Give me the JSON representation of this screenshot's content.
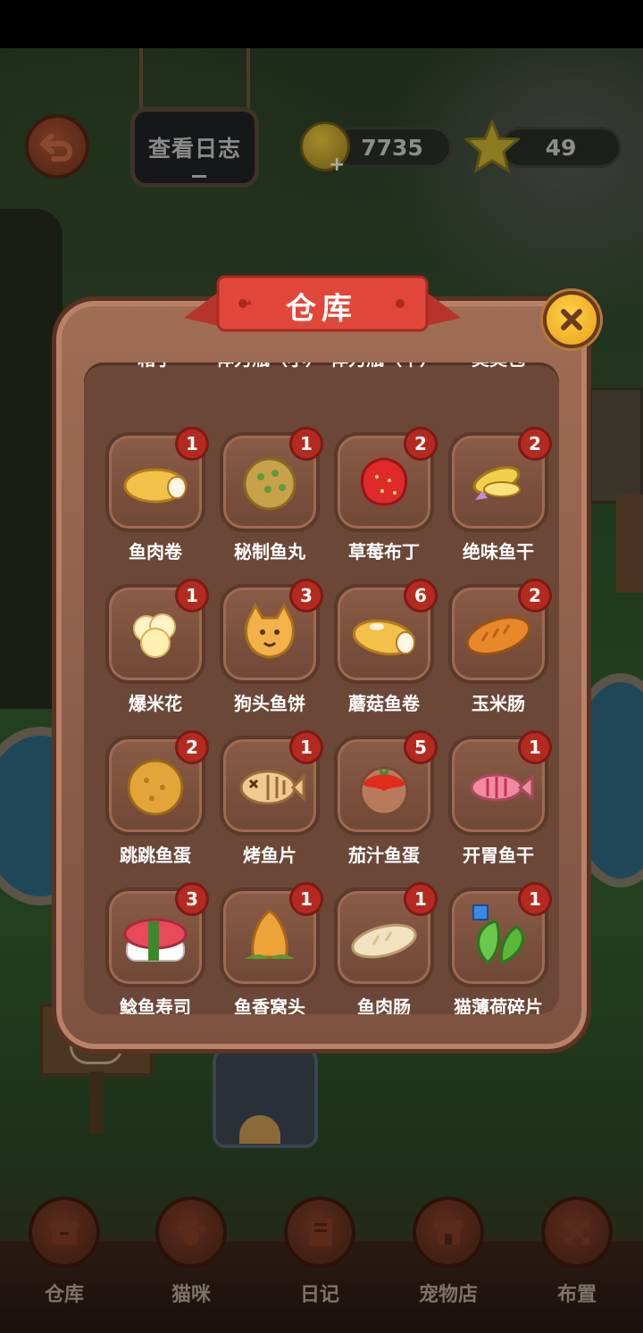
{
  "hud": {
    "log_button": "查看日志",
    "coins": "7735",
    "stars": "49"
  },
  "panel": {
    "title": "仓库",
    "top_row_labels": [
      "箱子",
      "体力瓶（小）",
      "体力瓶（中）",
      "臭臭包"
    ],
    "items": [
      {
        "name": "鱼肉卷",
        "count": "1",
        "icon": "fish-roll-icon"
      },
      {
        "name": "秘制鱼丸",
        "count": "1",
        "icon": "fish-ball-icon"
      },
      {
        "name": "草莓布丁",
        "count": "2",
        "icon": "strawberry-pudding-icon"
      },
      {
        "name": "绝味鱼干",
        "count": "2",
        "icon": "dried-fish-icon"
      },
      {
        "name": "爆米花",
        "count": "1",
        "icon": "popcorn-icon"
      },
      {
        "name": "狗头鱼饼",
        "count": "3",
        "icon": "dog-fish-cake-icon"
      },
      {
        "name": "蘑菇鱼卷",
        "count": "6",
        "icon": "mushroom-fish-roll-icon"
      },
      {
        "name": "玉米肠",
        "count": "2",
        "icon": "corn-sausage-icon"
      },
      {
        "name": "跳跳鱼蛋",
        "count": "2",
        "icon": "fish-egg-icon"
      },
      {
        "name": "烤鱼片",
        "count": "1",
        "icon": "grilled-fish-icon"
      },
      {
        "name": "茄汁鱼蛋",
        "count": "5",
        "icon": "tomato-fish-egg-icon"
      },
      {
        "name": "开胃鱼干",
        "count": "1",
        "icon": "appetizer-dried-fish-icon"
      },
      {
        "name": "鲶鱼寿司",
        "count": "3",
        "icon": "sushi-icon"
      },
      {
        "name": "鱼香窝头",
        "count": "1",
        "icon": "steamed-bun-icon"
      },
      {
        "name": "鱼肉肠",
        "count": "1",
        "icon": "fish-sausage-icon"
      },
      {
        "name": "猫薄荷碎片",
        "count": "1",
        "icon": "catnip-fragment-icon"
      }
    ]
  },
  "nav": [
    {
      "label": "仓库",
      "icon": "box-icon"
    },
    {
      "label": "猫咪",
      "icon": "paw-icon"
    },
    {
      "label": "日记",
      "icon": "notebook-icon"
    },
    {
      "label": "宠物店",
      "icon": "shop-icon"
    },
    {
      "label": "布置",
      "icon": "arrange-icon"
    }
  ],
  "colors": {
    "badge": "#b52a1f",
    "panel": "#7d5240",
    "ribbon": "#e0473a",
    "close": "#f5b82a"
  }
}
